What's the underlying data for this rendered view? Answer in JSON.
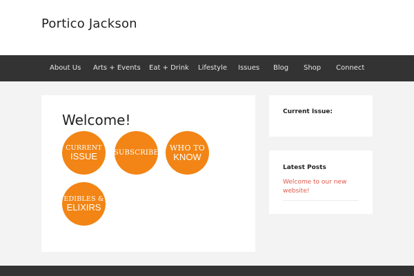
{
  "site": {
    "title": "Portico Jackson"
  },
  "nav": {
    "items": [
      {
        "label": "About Us"
      },
      {
        "label": "Arts + Events"
      },
      {
        "label": "Eat + Drink"
      },
      {
        "label": "Lifestyle"
      },
      {
        "label": "Issues"
      },
      {
        "label": "Blog"
      },
      {
        "label": "Shop"
      },
      {
        "label": "Connect"
      }
    ]
  },
  "main": {
    "heading": "Welcome!",
    "buttons": [
      {
        "line1": "Current",
        "line2": "Issue"
      },
      {
        "line1": "Subscribe"
      },
      {
        "line1": "Who to",
        "line2": "Know"
      },
      {
        "line1": "Edibles &",
        "line2": "Elixirs"
      }
    ]
  },
  "sidebar": {
    "current_issue": {
      "title": "Current Issue:"
    },
    "latest_posts": {
      "title": "Latest Posts",
      "posts": [
        {
          "title": "Welcome to our new website!"
        }
      ]
    }
  },
  "colors": {
    "accent": "#f28515",
    "nav_bg": "#333333",
    "link": "#e0584a",
    "page_bg": "#f3f3f3"
  }
}
